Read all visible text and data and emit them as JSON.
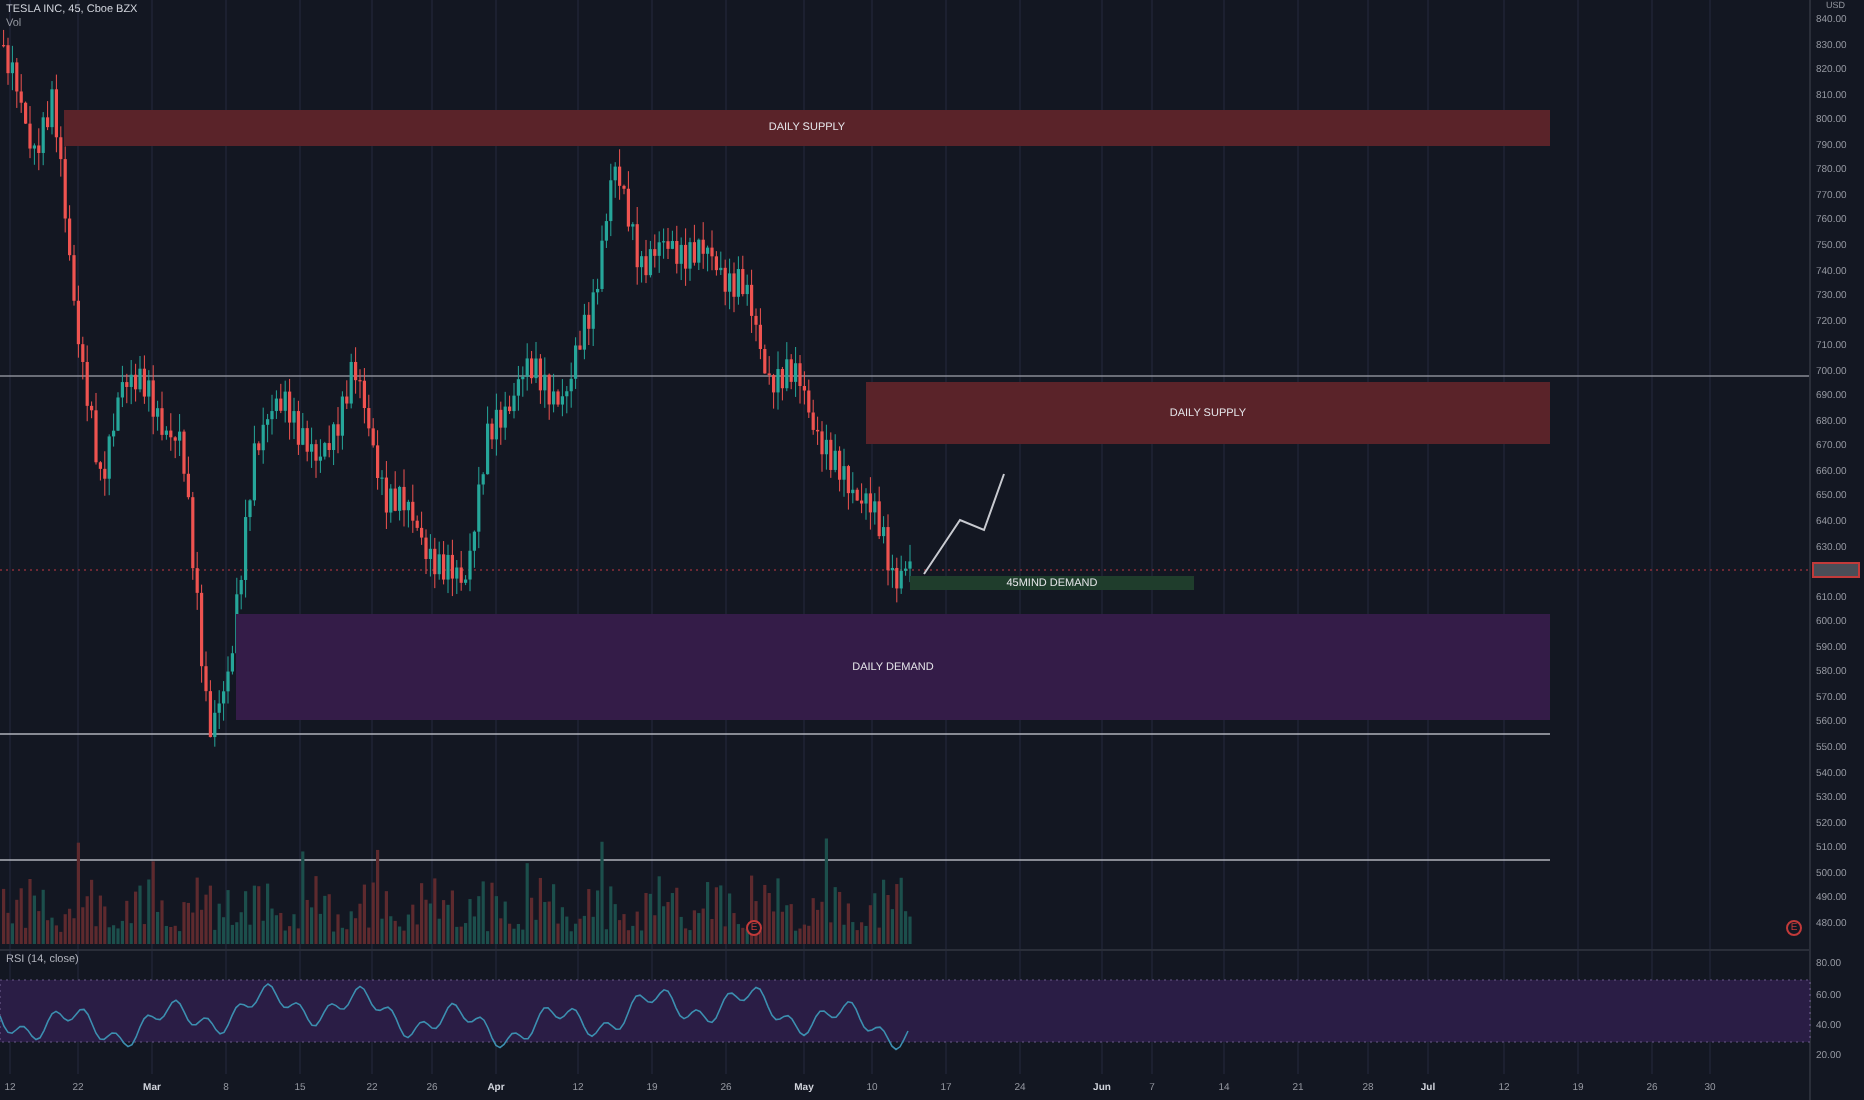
{
  "header": {
    "title": "TESLA INC, 45, Cboe BZX",
    "volume_label": "Vol"
  },
  "zones": [
    {
      "kind": "supply",
      "label": "DAILY SUPPLY"
    },
    {
      "kind": "supply",
      "label": "DAILY SUPPLY"
    },
    {
      "kind": "intraday",
      "label": "45MIND DEMAND"
    },
    {
      "kind": "demand",
      "label": "DAILY DEMAND"
    }
  ],
  "price_axis": {
    "currency": "USD",
    "labels": [
      "840.00",
      "830.00",
      "820.00",
      "810.00",
      "800.00",
      "790.00",
      "780.00",
      "770.00",
      "760.00",
      "750.00",
      "740.00",
      "730.00",
      "720.00",
      "710.00",
      "700.00",
      "690.00",
      "680.00",
      "670.00",
      "660.00",
      "650.00",
      "640.00",
      "630.00",
      "610.00",
      "600.00",
      "590.00",
      "580.00",
      "570.00",
      "560.00",
      "550.00",
      "540.00",
      "530.00",
      "520.00",
      "510.00",
      "500.00",
      "490.00",
      "480.00"
    ]
  },
  "earnings_markers": [
    "E",
    "E"
  ],
  "rsi": {
    "label": "RSI (14, close)",
    "axis_labels": [
      "80.00",
      "60.00",
      "40.00",
      "20.00"
    ]
  },
  "time_axis": [
    "12",
    "22",
    "Mar",
    "8",
    "15",
    "22",
    "26",
    "Apr",
    "12",
    "19",
    "26",
    "May",
    "10",
    "17",
    "24",
    "Jun",
    "7",
    "14",
    "21",
    "28",
    "Jul",
    "12",
    "19",
    "26",
    "30"
  ]
}
